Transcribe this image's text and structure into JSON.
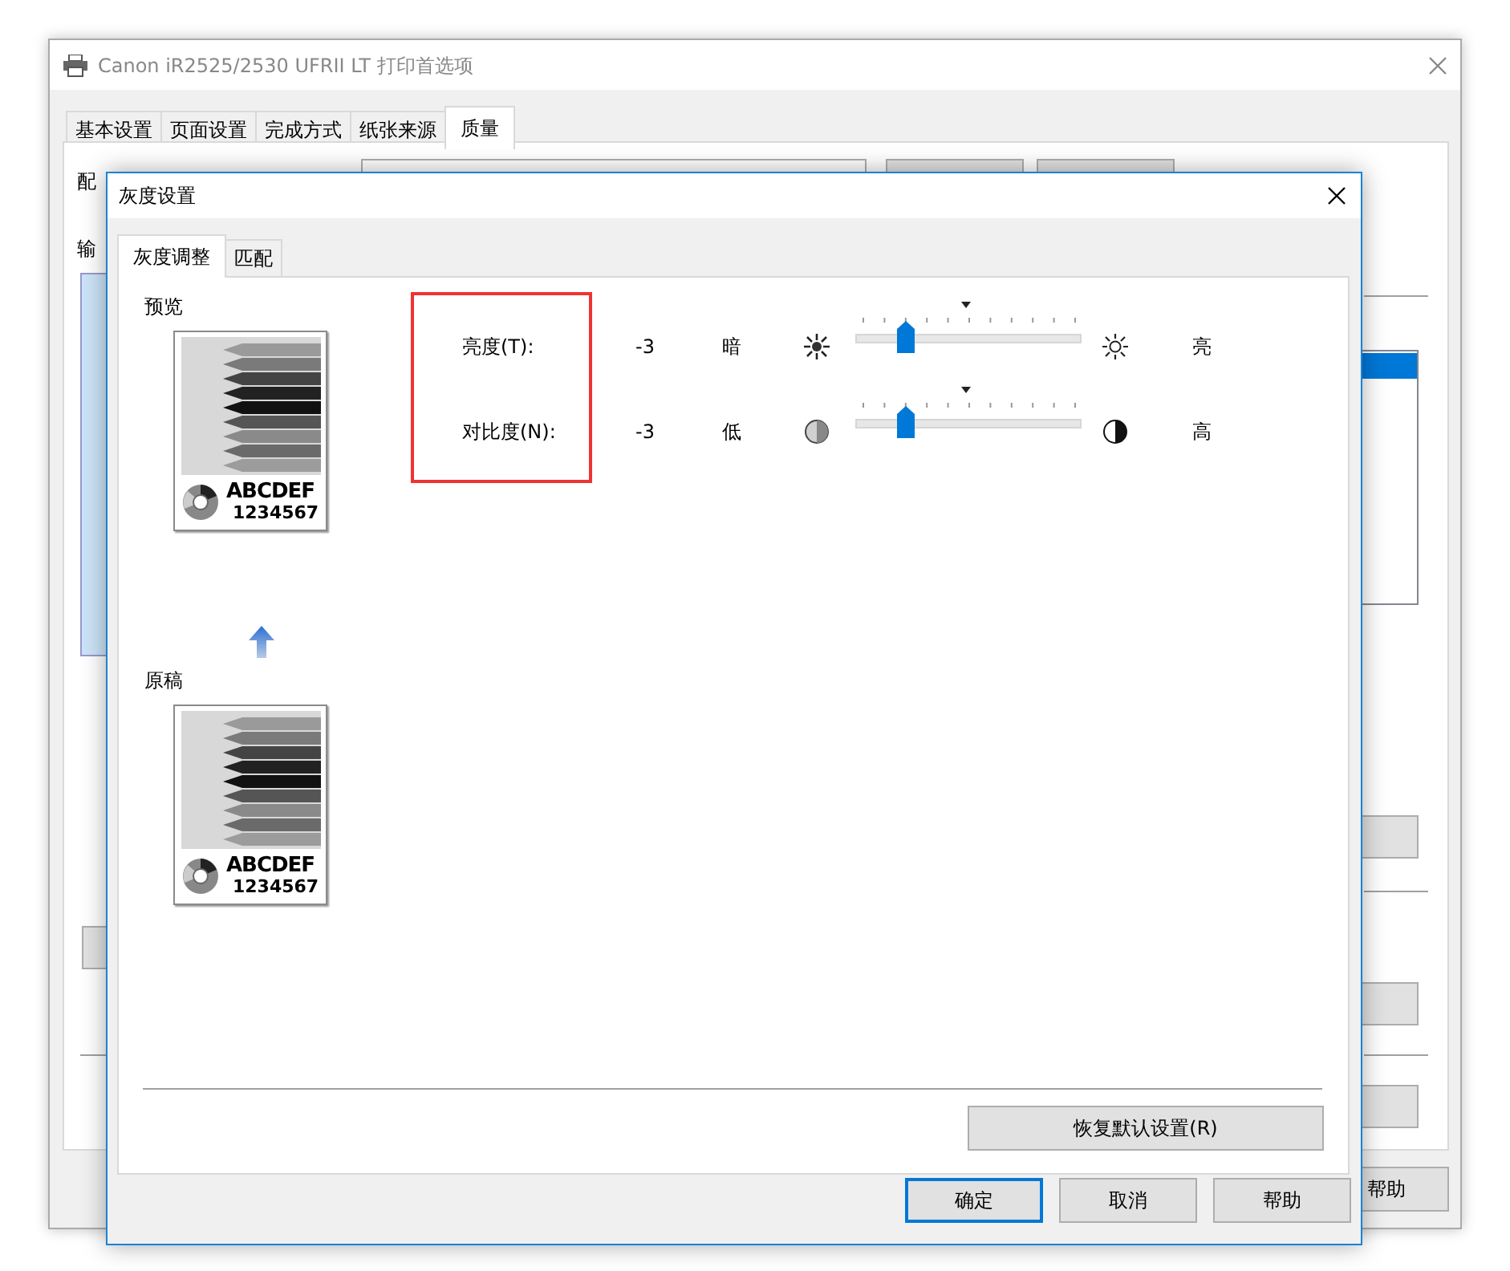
{
  "parent_window": {
    "title": "Canon iR2525/2530 UFRII LT 打印首选项",
    "tabs": [
      {
        "label": "基本设置",
        "selected": false
      },
      {
        "label": "页面设置",
        "selected": false
      },
      {
        "label": "完成方式",
        "selected": false
      },
      {
        "label": "纸张来源",
        "selected": false
      },
      {
        "label": "质量",
        "selected": true
      }
    ],
    "partial_labels": [
      "配",
      "输"
    ],
    "help_button": "帮助"
  },
  "dialog": {
    "title": "灰度设置",
    "tabs": [
      {
        "label": "灰度调整",
        "selected": true
      },
      {
        "label": "匹配",
        "selected": false
      }
    ],
    "preview_label": "预览",
    "original_label": "原稿",
    "samples": [
      {
        "line_1": "ABCDEF",
        "line_2": "1234567"
      },
      {
        "line_1": "ABCDEF",
        "line_2": "1234567"
      }
    ],
    "settings": [
      {
        "kind": "brightness",
        "label": "亮度(T):",
        "value": "-3",
        "low_label": "暗",
        "high_label": "亮",
        "level": 0.22
      },
      {
        "kind": "contrast",
        "label": "对比度(N):",
        "value": "-3",
        "low_label": "低",
        "high_label": "高",
        "level": 0.22
      }
    ],
    "restore_button": "恢复默认设置(R)",
    "buttons": [
      {
        "label": "确定",
        "default": true
      },
      {
        "label": "取消",
        "default": false
      },
      {
        "label": "帮助",
        "default": false
      }
    ]
  }
}
